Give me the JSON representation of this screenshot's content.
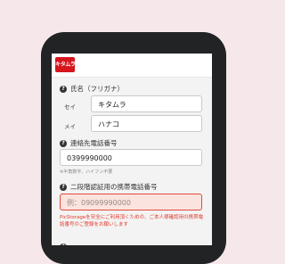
{
  "logo": {
    "text": "キタムラ",
    "color": "#d6151c"
  },
  "form": {
    "name": {
      "label": "氏名（フリガナ）",
      "icon": "question-circle-icon",
      "sei_label": "セイ",
      "sei_value": "キタムラ",
      "mei_label": "メイ",
      "mei_value": "ハナコ"
    },
    "contact": {
      "label": "連絡先電話番号",
      "icon": "question-circle-icon",
      "value": "0399990000",
      "note": "※半角数字、ハイフン不要"
    },
    "two_factor": {
      "label": "二段階認証用の携帯電話番号",
      "icon": "question-circle-icon",
      "placeholder": "例：09099990000",
      "error": "PicStorageを安全にご利用頂くための、ご本人様確認用の携帯電話番号のご登録をお願いします"
    }
  },
  "colors": {
    "error": "#e23a2a",
    "error_bg": "#fbe3df"
  }
}
